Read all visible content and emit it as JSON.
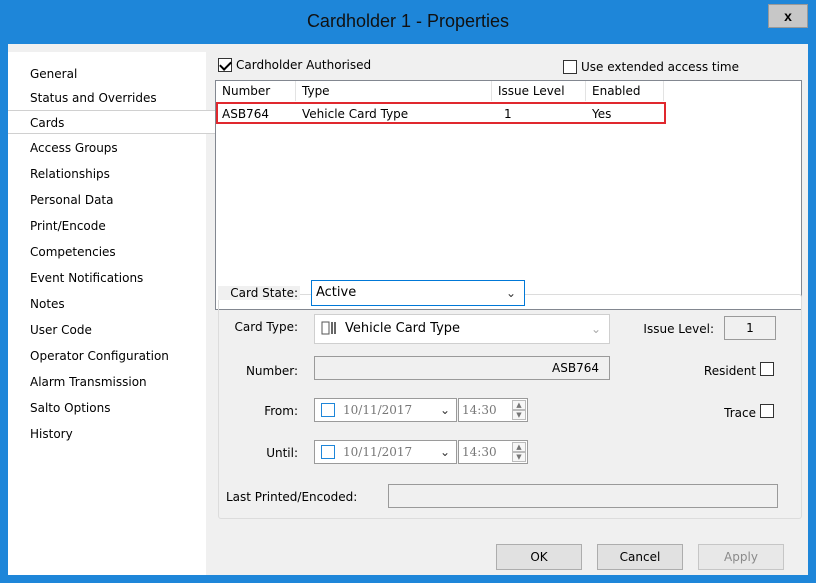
{
  "window": {
    "title": "Cardholder 1 - Properties",
    "close_glyph": "x"
  },
  "sidebar": {
    "items": [
      {
        "label": "General"
      },
      {
        "label": "Status and Overrides"
      },
      {
        "label": "Cards"
      },
      {
        "label": "Access Groups"
      },
      {
        "label": "Relationships"
      },
      {
        "label": "Personal Data"
      },
      {
        "label": "Print/Encode"
      },
      {
        "label": "Competencies"
      },
      {
        "label": "Event Notifications"
      },
      {
        "label": "Notes"
      },
      {
        "label": "User Code"
      },
      {
        "label": "Operator Configuration"
      },
      {
        "label": "Alarm Transmission"
      },
      {
        "label": "Salto Options"
      },
      {
        "label": "History"
      }
    ],
    "selected": "Cards"
  },
  "options": {
    "authorised_label": "Cardholder Authorised",
    "authorised_checked": true,
    "extended_label": "Use extended access time",
    "extended_checked": false
  },
  "cards_table": {
    "columns": [
      "Number",
      "Type",
      "Issue Level",
      "Enabled"
    ],
    "rows": [
      {
        "number": "ASB764",
        "type": "Vehicle Card Type",
        "issue_level": "1",
        "enabled": "Yes"
      }
    ]
  },
  "details": {
    "card_state_label": "Card State:",
    "card_state_value": "Active",
    "card_type_label": "Card Type:",
    "card_type_value": "Vehicle Card Type",
    "issue_level_label": "Issue Level:",
    "issue_level_value": "1",
    "number_label": "Number:",
    "number_value": "ASB764",
    "resident_label": "Resident",
    "trace_label": "Trace",
    "from_label": "From:",
    "from_date": "10/11/2017",
    "from_time": "14:30",
    "until_label": "Until:",
    "until_date": "10/11/2017",
    "until_time": "14:30",
    "last_printed_label": "Last Printed/Encoded:",
    "last_printed_value": ""
  },
  "buttons": {
    "ok": "OK",
    "cancel": "Cancel",
    "apply": "Apply"
  },
  "colors": {
    "titlebar": "#1e86d9",
    "selection_outline": "#e0282e",
    "focus_border": "#0078d7"
  }
}
